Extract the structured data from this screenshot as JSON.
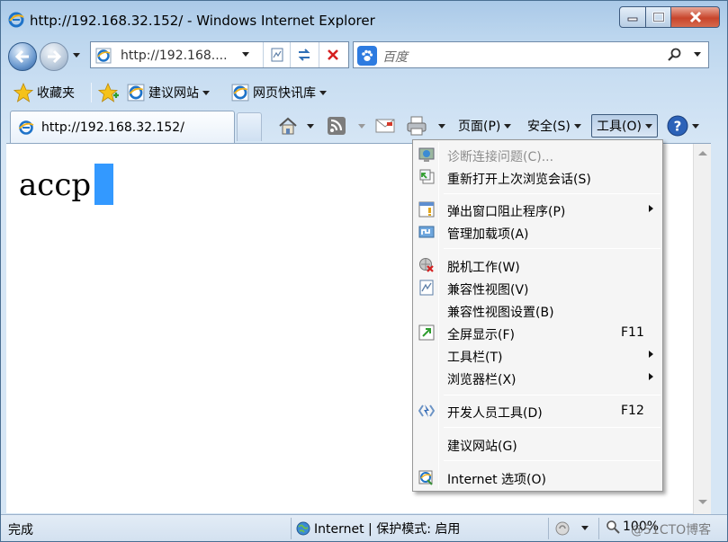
{
  "window": {
    "title": "http://192.168.32.152/ - Windows Internet Explorer"
  },
  "address_bar": {
    "url": "http://192.168.32.152/",
    "url_display": "http://192.168....",
    "compat_icon": "compat-view-icon",
    "refresh_icon": "refresh-icon",
    "stop_icon": "stop-icon"
  },
  "search": {
    "placeholder": "百度",
    "provider_icon": "baidu-paw-icon"
  },
  "favorites_bar": {
    "favorites_label": "收藏夹",
    "items": [
      {
        "label": "建议网站",
        "icon": "ie-icon"
      },
      {
        "label": "网页快讯库",
        "icon": "ie-icon"
      }
    ]
  },
  "tab": {
    "title": "http://192.168.32.152/"
  },
  "command_bar": {
    "page_label": "页面(P)",
    "safety_label": "安全(S)",
    "tools_label": "工具(O)"
  },
  "content": {
    "text": "accp"
  },
  "tools_menu": {
    "items": [
      {
        "label": "诊断连接问题(C)...",
        "icon": "diagnose-icon",
        "disabled": true
      },
      {
        "label": "重新打开上次浏览会话(S)",
        "icon": "reopen-session-icon"
      },
      {
        "label": "弹出窗口阻止程序(P)",
        "icon": "popup-blocker-icon",
        "submenu": true
      },
      {
        "label": "管理加载项(A)",
        "icon": "addons-icon"
      },
      {
        "label": "脱机工作(W)",
        "icon": "offline-icon"
      },
      {
        "label": "兼容性视图(V)",
        "icon": "compat-view-icon"
      },
      {
        "label": "兼容性视图设置(B)"
      },
      {
        "label": "全屏显示(F)",
        "icon": "fullscreen-icon",
        "shortcut": "F11"
      },
      {
        "label": "工具栏(T)",
        "submenu": true
      },
      {
        "label": "浏览器栏(X)",
        "submenu": true
      },
      {
        "label": "开发人员工具(D)",
        "icon": "devtools-icon",
        "shortcut": "F12"
      },
      {
        "label": "建议网站(G)"
      },
      {
        "label": "Internet 选项(O)",
        "icon": "internet-options-icon"
      }
    ]
  },
  "status_bar": {
    "status": "完成",
    "zone": "Internet | 保护模式: 启用",
    "zoom": "100%",
    "watermark": "@51CTO博客"
  },
  "colors": {
    "chrome": "#c9def2",
    "selection": "#3399ff",
    "close_button": "#c8452c"
  }
}
